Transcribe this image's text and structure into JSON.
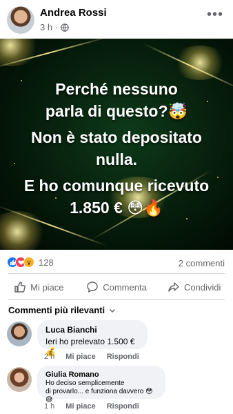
{
  "post": {
    "author": "Andrea Rossi",
    "time": "3 h",
    "separator": "·",
    "more": "•••",
    "image_text": {
      "line1": "Perché nessuno",
      "line2": "parla di questo?🤯",
      "line3": "Non è stato depositato",
      "line4": "nulla.",
      "line5": "E ho comunque ricevuto",
      "line6": "1.850 € 😳🔥"
    },
    "reactions": {
      "icons": [
        "like-icon",
        "love-icon",
        "wow-icon"
      ],
      "count": "128"
    },
    "comments_count": "2 commenti"
  },
  "actions": {
    "like": "Mi piace",
    "comment": "Commenta",
    "share": "Condividi"
  },
  "comments_section": {
    "sort_label": "Commenti più rilevanti"
  },
  "comments": [
    {
      "author": "Luca Bianchi",
      "text": "Ieri ho prelevato 1.500 € 💰",
      "time": "2 h",
      "like": "Mi piace",
      "reply": "Rispondi"
    },
    {
      "author": "Giulia Romano",
      "text_line1": "Ho deciso semplicemente",
      "text_line2": "di provarlo... e funziona davvero 😳😅",
      "time": "1 h",
      "like": "Mi piace",
      "reply": "Rispondi"
    }
  ],
  "colors": {
    "accent": "#1877f2",
    "muted": "#65676b",
    "bubble": "#f0f2f5",
    "image_bg": "#08240f"
  }
}
